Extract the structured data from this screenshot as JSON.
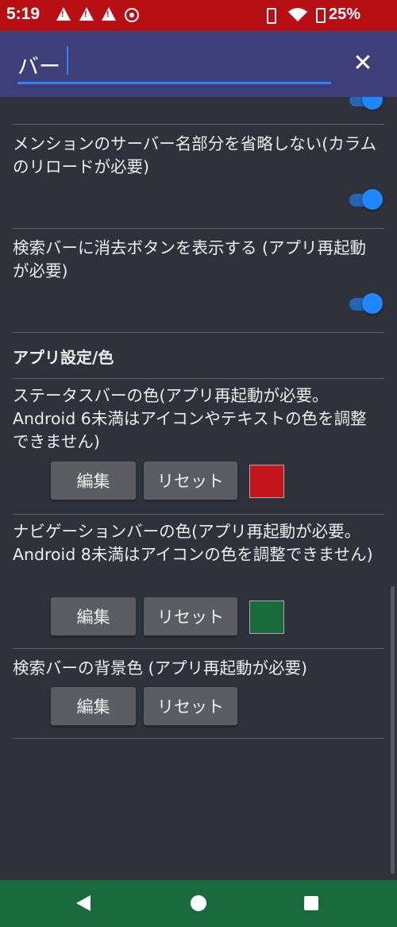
{
  "status_bar": {
    "time": "5:19",
    "battery": "25%",
    "icons": [
      "warning-icon",
      "warning-icon",
      "warning-icon",
      "sync-icon",
      "vibrate-icon",
      "wifi-icon",
      "battery-icon"
    ]
  },
  "search": {
    "value": "バー",
    "clear_icon": "close-icon"
  },
  "settings": {
    "mention_server": {
      "label": "メンションのサーバー名部分を省略しない(カラムのリロードが必要)",
      "enabled": true
    },
    "search_clear_button": {
      "label": "検索バーに消去ボタンを表示する (アプリ再起動が必要)",
      "enabled": true
    },
    "section_title": "アプリ設定/色",
    "status_bar_color": {
      "label": "ステータスバーの色(アプリ再起動が必要。Android 6未満はアイコンやテキストの色を調整できません)",
      "edit_label": "編集",
      "reset_label": "リセット",
      "color": "#c4161a"
    },
    "nav_bar_color": {
      "label": "ナビゲーションバーの色(アプリ再起動が必要。Android 8未満はアイコンの色を調整できません)",
      "edit_label": "編集",
      "reset_label": "リセット",
      "color": "#196b3e"
    },
    "search_bar_bg": {
      "label": "検索バーの背景色 (アプリ再起動が必要)",
      "edit_label": "編集",
      "reset_label": "リセット"
    }
  },
  "nav_bar": {
    "icons": [
      "back-icon",
      "home-icon",
      "recents-icon"
    ]
  },
  "colors": {
    "status_bar": "#b80f15",
    "header": "#3e3e78",
    "background": "#2f323b",
    "accent": "#1f86ff"
  }
}
